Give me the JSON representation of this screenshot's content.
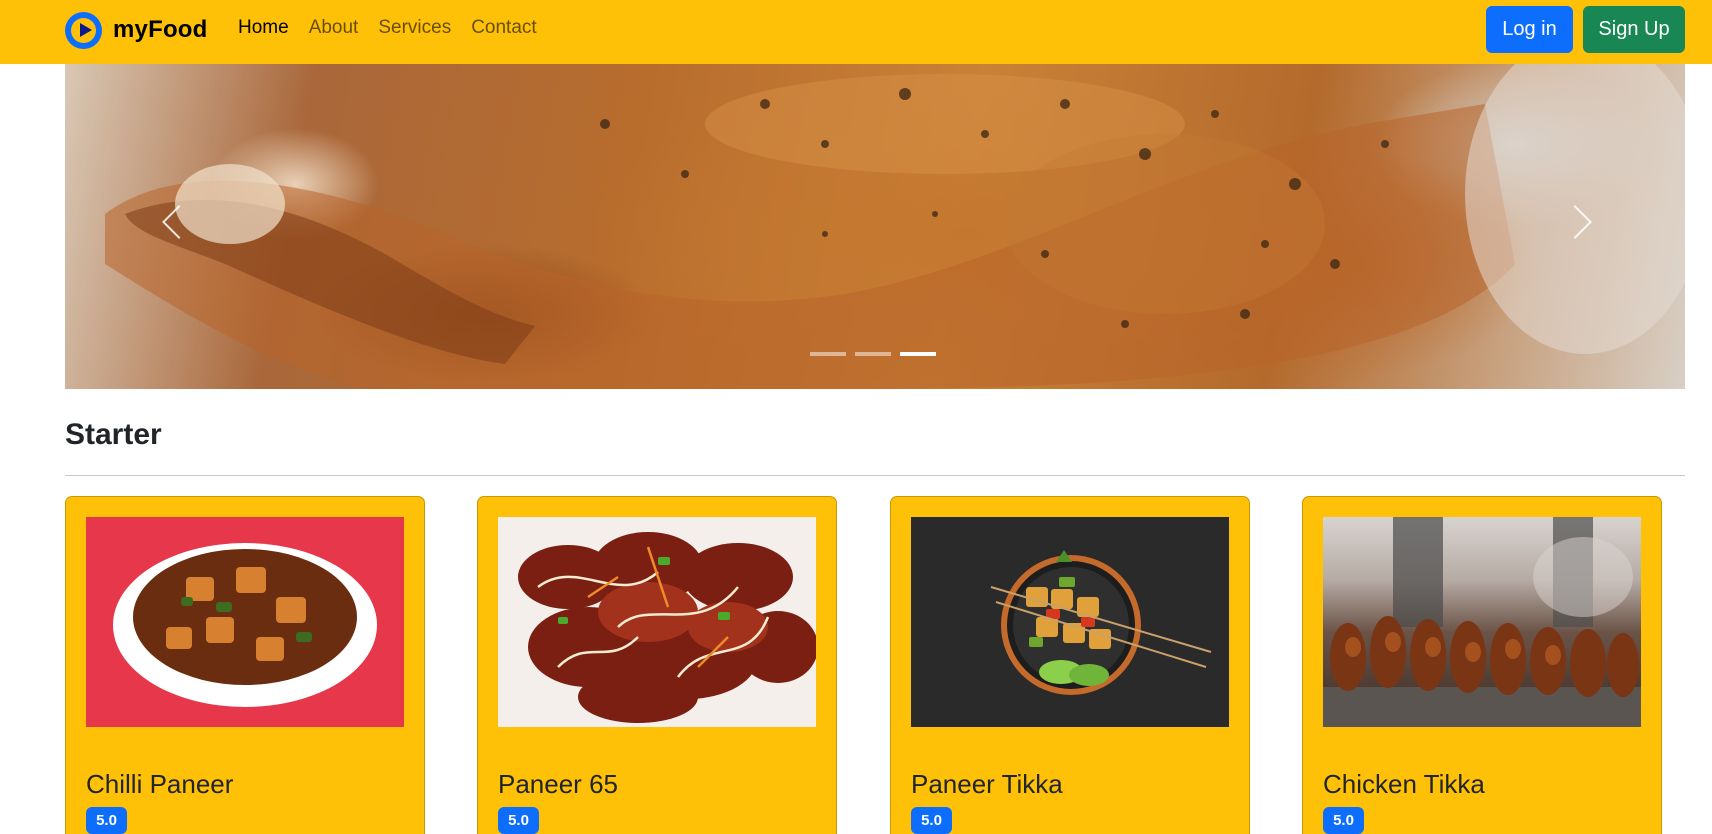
{
  "brand": {
    "name": "myFood"
  },
  "nav": {
    "links": [
      {
        "label": "Home",
        "active": true
      },
      {
        "label": "About",
        "active": false
      },
      {
        "label": "Services",
        "active": false
      },
      {
        "label": "Contact",
        "active": false
      }
    ],
    "login_label": "Log in",
    "signup_label": "Sign Up"
  },
  "carousel": {
    "slide_count": 3,
    "active_index": 2
  },
  "section": {
    "title": "Starter"
  },
  "cards": [
    {
      "title": "Chilli Paneer",
      "rating": "5.0"
    },
    {
      "title": "Paneer 65",
      "rating": "5.0"
    },
    {
      "title": "Paneer Tikka",
      "rating": "5.0"
    },
    {
      "title": "Chicken Tikka",
      "rating": "5.0"
    }
  ],
  "colors": {
    "navbar": "#ffc107",
    "primary": "#0d6efd",
    "success": "#198754",
    "card": "#ffc107"
  }
}
